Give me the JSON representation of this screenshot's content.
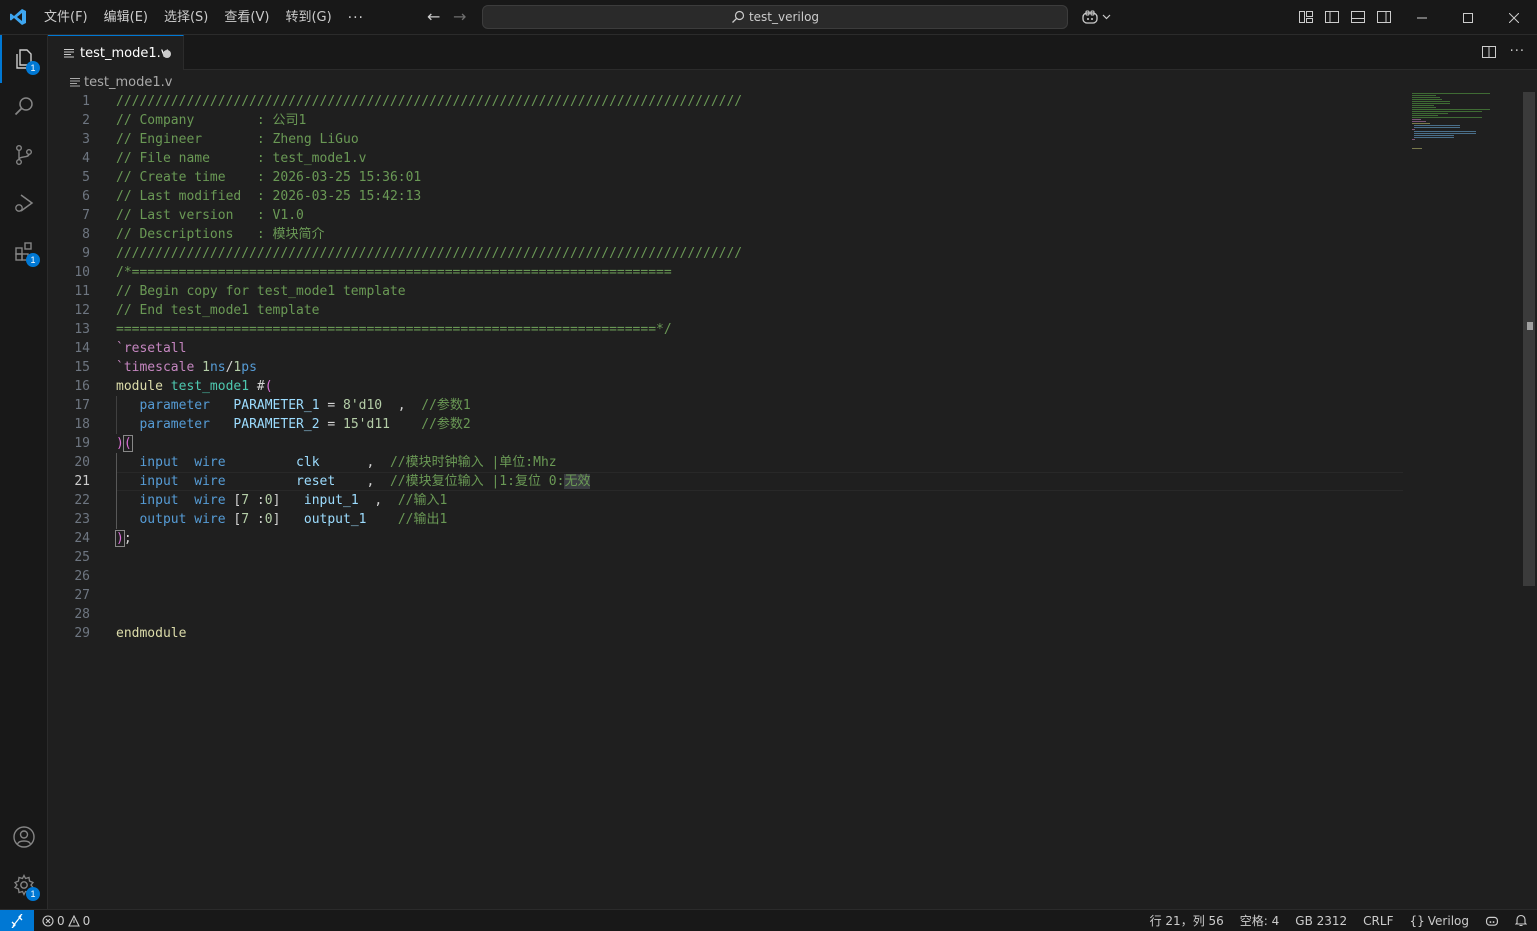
{
  "titlebar": {
    "menu": [
      "文件(F)",
      "编辑(E)",
      "选择(S)",
      "查看(V)",
      "转到(G)"
    ],
    "more": "···",
    "search_text": "test_verilog"
  },
  "activity": {
    "explorer_badge": "1",
    "extensions_badge": "1",
    "manage_badge": "1"
  },
  "tab": {
    "label": "test_mode1.v"
  },
  "breadcrumb": {
    "file": "test_mode1.v"
  },
  "editor": {
    "line_numbers": [
      "1",
      "2",
      "3",
      "4",
      "5",
      "6",
      "7",
      "8",
      "9",
      "10",
      "11",
      "12",
      "13",
      "14",
      "15",
      "16",
      "17",
      "18",
      "19",
      "20",
      "21",
      "22",
      "23",
      "24",
      "25",
      "26",
      "27",
      "28",
      "29"
    ],
    "current_line": 21,
    "header": {
      "rule": "////////////////////////////////////////////////////////////////////////////////",
      "company_key": "// Company        : ",
      "company": "公司1",
      "engineer_key": "// Engineer       : ",
      "engineer": "Zheng LiGuo",
      "filename_key": "// File name      : ",
      "filename": "test_mode1.v",
      "create_key": "// Create time    : ",
      "create": "2026-03-25 15:36:01",
      "modified_key": "// Last modified  : ",
      "modified": "2026-03-25 15:42:13",
      "version_key": "// Last version   : ",
      "version": "V1.0",
      "desc_key": "// Descriptions   : ",
      "desc": "模块简介"
    },
    "template": {
      "open": "/*=====================================================================",
      "begin": "// Begin copy for test_mode1 template",
      "end": "// End test_mode1 template",
      "close": "=====================================================================*/"
    },
    "code": {
      "resetall": "`resetall",
      "timescale_kw": "`timescale",
      "ts_1a": "1",
      "ts_ns": "ns",
      "ts_slash": "/",
      "ts_1b": "1",
      "ts_ps": "ps",
      "module_kw": "module",
      "module_name": "test_mode1",
      "hash_paren": "#",
      "param_kw": "parameter",
      "p1_name": "PARAMETER_1",
      "p1_val_a": "8'd",
      "p1_val_b": "10",
      "p1_comment": "//参数1",
      "p2_name": "PARAMETER_2",
      "p2_val_a": "15'd",
      "p2_val_b": "11",
      "p2_comment": "//参数2",
      "input_kw": "input",
      "output_kw": "output",
      "wire_kw": "wire",
      "clk": "clk",
      "clk_comment": "//模块时钟输入 |单位:Mhz",
      "reset": "reset",
      "reset_comment_a": "//模块复位输入 |1:复位 0:",
      "reset_comment_b": "无效",
      "input_1": "input_1",
      "input_1_comment": "//输入1",
      "output_1": "output_1",
      "output_1_comment": "//输出1",
      "range_open": "[",
      "range_7": "7",
      "range_colon": " :",
      "range_0": "0",
      "range_close": "]",
      "endmodule": "endmodule"
    }
  },
  "statusbar": {
    "errors": "0",
    "warnings": "0",
    "position": "行 21，列 56",
    "spaces": "空格: 4",
    "encoding": "GB 2312",
    "eol": "CRLF",
    "language": "Verilog"
  },
  "colors": {
    "accent": "#0078d4",
    "comment": "#6a9955",
    "keyword": "#569cd6",
    "directive": "#c586c0",
    "type": "#4ec9b0",
    "identifier": "#9cdcfe",
    "number": "#b5cea8",
    "bracket": "#ffd700"
  }
}
